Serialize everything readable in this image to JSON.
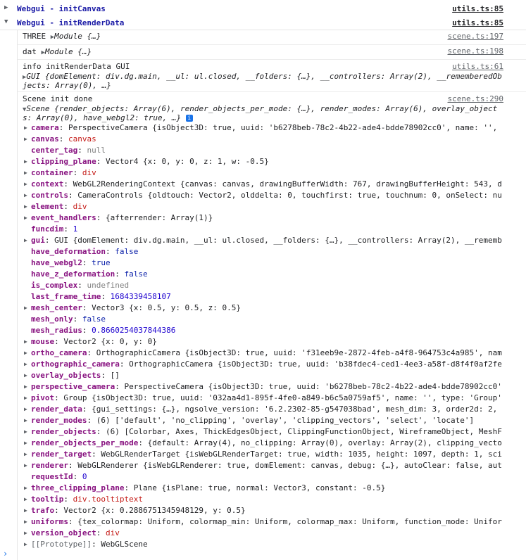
{
  "groups": [
    {
      "label": "Webgui - initCanvas",
      "source": "utils.ts:85",
      "expanded": false
    },
    {
      "label": "Webgui - initRenderData",
      "source": "utils.ts:85",
      "expanded": true
    }
  ],
  "messages": [
    {
      "prefix": "THREE",
      "object": "Module {…}",
      "source": "scene.ts:197"
    },
    {
      "prefix": "dat",
      "object": "Module {…}",
      "source": "scene.ts:198"
    },
    {
      "prefix": "info initRenderData GUI",
      "line2": "GUI {domElement: div.dg.main, __ul: ul.closed, __folders: {…}, __controllers: Array(2), __rememberedOb",
      "line3": "jects: Array(0), …}",
      "source": "utils.ts:61"
    },
    {
      "prefix": "Scene init done",
      "line2": "Scene {render_objects: Array(6), render_objects_per_mode: {…}, render_modes: Array(6), overlay_object",
      "line3": "s: Array(0), have_webgl2: true, …}",
      "source": "scene.ts:290"
    }
  ],
  "properties": [
    {
      "key": "camera",
      "value": "PerspectiveCamera {isObject3D: true, uuid: 'b6278beb-78c2-4b22-ade4-bdde78902cc0', name: '',",
      "expandable": true
    },
    {
      "key": "canvas",
      "value": "canvas",
      "expandable": true,
      "vclass": "v-str"
    },
    {
      "key": "center_tag",
      "value": "null",
      "expandable": false,
      "vclass": "v-null"
    },
    {
      "key": "clipping_plane",
      "value": "Vector4 {x: 0, y: 0, z: 1, w: -0.5}",
      "expandable": true
    },
    {
      "key": "container",
      "value": "div",
      "expandable": true,
      "vclass": "v-str"
    },
    {
      "key": "context",
      "value": "WebGL2RenderingContext {canvas: canvas, drawingBufferWidth: 767, drawingBufferHeight: 543, d",
      "expandable": true
    },
    {
      "key": "controls",
      "value": "CameraControls {oldtouch: Vector2, olddelta: 0, touchfirst: true, touchnum: 0, onSelect: nu",
      "expandable": true
    },
    {
      "key": "element",
      "value": "div",
      "expandable": true,
      "vclass": "v-str"
    },
    {
      "key": "event_handlers",
      "value": "{afterrender: Array(1)}",
      "expandable": true
    },
    {
      "key": "funcdim",
      "value": "1",
      "expandable": false,
      "vclass": "v-num"
    },
    {
      "key": "gui",
      "value": "GUI {domElement: div.dg.main, __ul: ul.closed, __folders: {…}, __controllers: Array(2), __rememb",
      "expandable": true
    },
    {
      "key": "have_deformation",
      "value": "false",
      "expandable": false,
      "vclass": "v-bool"
    },
    {
      "key": "have_webgl2",
      "value": "true",
      "expandable": false,
      "vclass": "v-bool"
    },
    {
      "key": "have_z_deformation",
      "value": "false",
      "expandable": false,
      "vclass": "v-bool"
    },
    {
      "key": "is_complex",
      "value": "undefined",
      "expandable": false,
      "vclass": "v-null"
    },
    {
      "key": "last_frame_time",
      "value": "1684339458107",
      "expandable": false,
      "vclass": "v-num"
    },
    {
      "key": "mesh_center",
      "value": "Vector3 {x: 0.5, y: 0.5, z: 0.5}",
      "expandable": true
    },
    {
      "key": "mesh_only",
      "value": "false",
      "expandable": false,
      "vclass": "v-bool"
    },
    {
      "key": "mesh_radius",
      "value": "0.8660254037844386",
      "expandable": false,
      "vclass": "v-num"
    },
    {
      "key": "mouse",
      "value": "Vector2 {x: 0, y: 0}",
      "expandable": true
    },
    {
      "key": "ortho_camera",
      "value": "OrthographicCamera {isObject3D: true, uuid: 'f31eeb9e-2872-4feb-a4f8-964753c4a985', nam",
      "expandable": true
    },
    {
      "key": "orthographic_camera",
      "value": "OrthographicCamera {isObject3D: true, uuid: 'b38fdec4-ced1-4ee3-a58f-d8f4f0af2fe",
      "expandable": true
    },
    {
      "key": "overlay_objects",
      "value": "[]",
      "expandable": true
    },
    {
      "key": "perspective_camera",
      "value": "PerspectiveCamera {isObject3D: true, uuid: 'b6278beb-78c2-4b22-ade4-bdde78902cc0'",
      "expandable": true
    },
    {
      "key": "pivot",
      "value": "Group {isObject3D: true, uuid: '032aa4d1-895f-4fe0-a849-b6c5a0759af5', name: '', type: 'Group'",
      "expandable": true
    },
    {
      "key": "render_data",
      "value": "{gui_settings: {…}, ngsolve_version: '6.2.2302-85-g547038bad', mesh_dim: 3, order2d: 2,",
      "expandable": true
    },
    {
      "key": "render_modes",
      "value": "(6) ['default', 'no_clipping', 'overlay', 'clipping_vectors', 'select', 'locate']",
      "expandable": true
    },
    {
      "key": "render_objects",
      "value": "(6) [Colorbar, Axes, ThickEdgesObject, ClippingFunctionObject, WireframeObject, MeshF",
      "expandable": true
    },
    {
      "key": "render_objects_per_mode",
      "value": "{default: Array(4), no_clipping: Array(0), overlay: Array(2), clipping_vecto",
      "expandable": true
    },
    {
      "key": "render_target",
      "value": "WebGLRenderTarget {isWebGLRenderTarget: true, width: 1035, height: 1097, depth: 1, sci",
      "expandable": true
    },
    {
      "key": "renderer",
      "value": "WebGLRenderer {isWebGLRenderer: true, domElement: canvas, debug: {…}, autoClear: false, aut",
      "expandable": true
    },
    {
      "key": "requestId",
      "value": "0",
      "expandable": false,
      "vclass": "v-num"
    },
    {
      "key": "three_clipping_plane",
      "value": "Plane {isPlane: true, normal: Vector3, constant: -0.5}",
      "expandable": true
    },
    {
      "key": "tooltip",
      "value": "div.tooltiptext",
      "expandable": true,
      "vclass": "v-str"
    },
    {
      "key": "trafo",
      "value": "Vector2 {x: 0.2886751345948129, y: 0.5}",
      "expandable": true
    },
    {
      "key": "uniforms",
      "value": "{tex_colormap: Uniform, colormap_min: Uniform, colormap_max: Uniform, function_mode: Unifor",
      "expandable": true
    },
    {
      "key": "version_object",
      "value": "div",
      "expandable": true,
      "vclass": "v-str"
    },
    {
      "key": "[[Prototype]]",
      "value": "WebGLScene",
      "expandable": true,
      "proto": true
    }
  ],
  "prompt": "›"
}
